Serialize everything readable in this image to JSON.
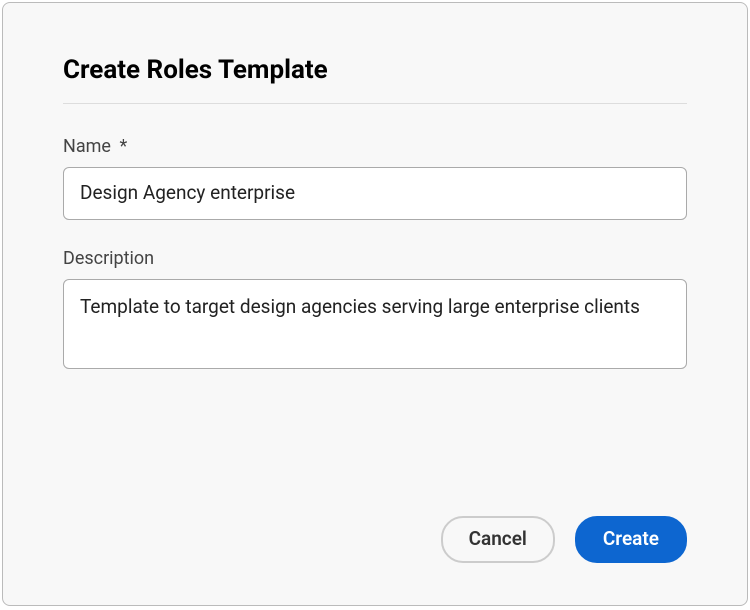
{
  "dialog": {
    "title": "Create Roles Template",
    "fields": {
      "name": {
        "label": "Name",
        "required_mark": "*",
        "value": "Design Agency enterprise"
      },
      "description": {
        "label": "Description",
        "value": "Template to target design agencies serving large enterprise clients"
      }
    },
    "buttons": {
      "cancel": "Cancel",
      "create": "Create"
    }
  }
}
